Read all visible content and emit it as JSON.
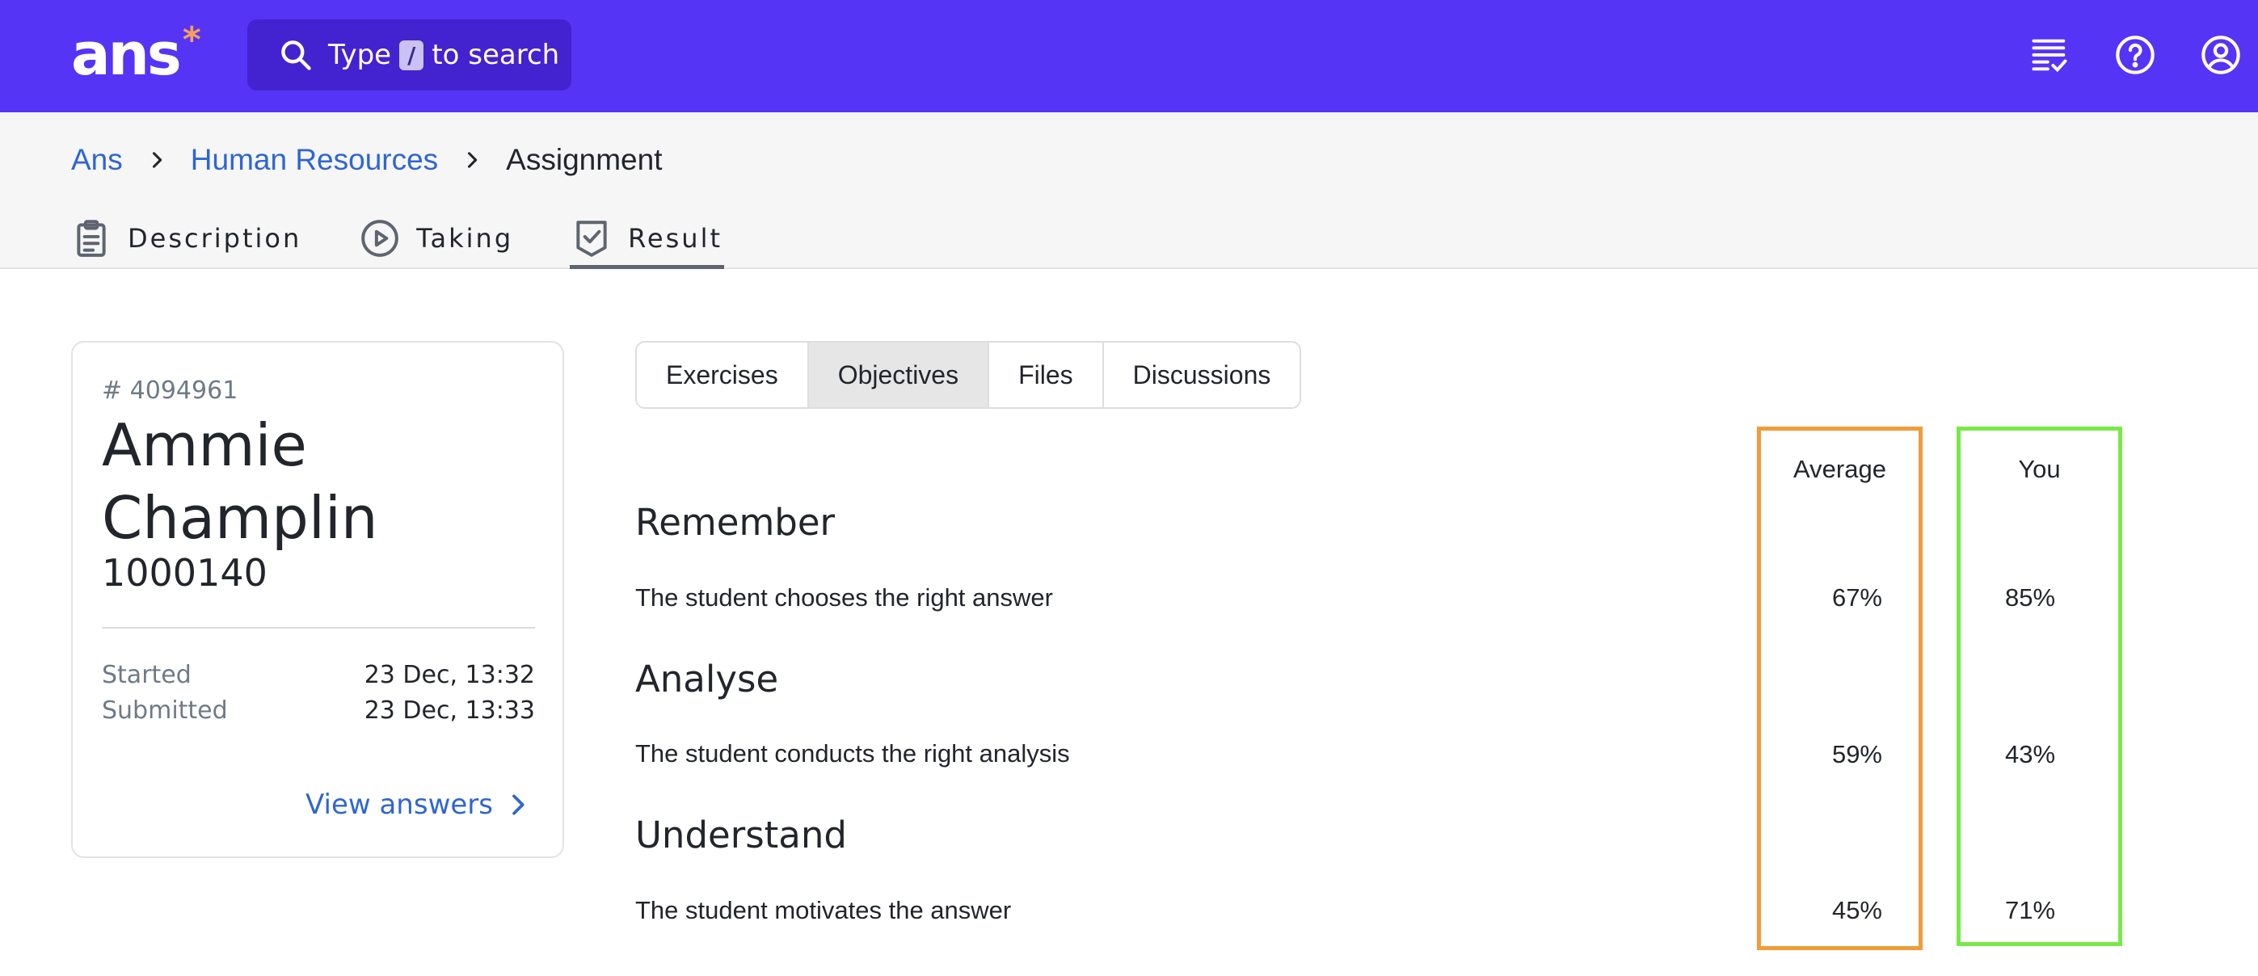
{
  "app": {
    "logo_text": "ans",
    "logo_mark": "*"
  },
  "search": {
    "prefix": "Type",
    "shortcut": "/",
    "suffix": "to search"
  },
  "header_icons": [
    "checklist-icon",
    "help-icon",
    "account-icon"
  ],
  "breadcrumb": [
    {
      "label": "Ans",
      "link": true
    },
    {
      "label": "Human Resources",
      "link": true
    },
    {
      "label": "Assignment",
      "link": false
    }
  ],
  "page_tabs": [
    {
      "label": "Description",
      "icon": "clipboard-icon",
      "active": false
    },
    {
      "label": "Taking",
      "icon": "play-icon",
      "active": false
    },
    {
      "label": "Result",
      "icon": "check-shield-icon",
      "active": true
    }
  ],
  "student": {
    "id": "# 4094961",
    "name_line1": "Ammie",
    "name_line2": "Champlin",
    "number": "1000140",
    "started_label": "Started",
    "started_value": "23 Dec, 13:32",
    "submitted_label": "Submitted",
    "submitted_value": "23 Dec, 13:33",
    "view_answers": "View answers"
  },
  "result_tabs": [
    {
      "label": "Exercises",
      "active": false
    },
    {
      "label": "Objectives",
      "active": true
    },
    {
      "label": "Files",
      "active": false
    },
    {
      "label": "Discussions",
      "active": false
    }
  ],
  "columns": {
    "average": "Average",
    "you": "You"
  },
  "objectives": [
    {
      "category": "Remember",
      "text": "The student chooses the right answer",
      "average": "67%",
      "you": "85%"
    },
    {
      "category": "Analyse",
      "text": "The student conducts the right analysis",
      "average": "59%",
      "you": "43%"
    },
    {
      "category": "Understand",
      "text": "The student motivates the answer",
      "average": "45%",
      "you": "71%"
    }
  ],
  "colors": {
    "brand": "#5634f5",
    "link": "#2f66d0",
    "average_outline": "#f19c38",
    "you_outline": "#78ea48"
  }
}
